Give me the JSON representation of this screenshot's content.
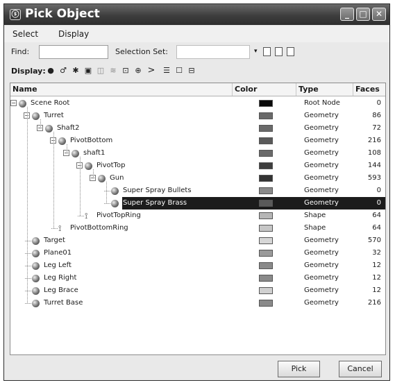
{
  "window": {
    "title": "Pick Object",
    "icon": "max-app-icon"
  },
  "menu": [
    "Select",
    "Display"
  ],
  "find": {
    "label": "Find:",
    "value": "",
    "selection_set_label": "Selection Set:",
    "selection_set_value": ""
  },
  "display_label": "Display:",
  "columns": {
    "name": "Name",
    "color": "Color",
    "type": "Type",
    "faces": "Faces"
  },
  "rows": [
    {
      "name": "Scene Root",
      "type": "Root Node",
      "faces": "0",
      "color": "#0a0a0a",
      "level": 0,
      "icon": "scene-root-icon"
    },
    {
      "name": "Turret",
      "type": "Geometry",
      "faces": "86",
      "color": "#6a6a6a",
      "level": 1,
      "icon": "geometry-sphere-icon"
    },
    {
      "name": "Shaft2",
      "type": "Geometry",
      "faces": "72",
      "color": "#6a6a6a",
      "level": 2,
      "icon": "geometry-sphere-icon"
    },
    {
      "name": "PivotBottom",
      "type": "Geometry",
      "faces": "216",
      "color": "#5a5a5a",
      "level": 3,
      "icon": "geometry-sphere-icon"
    },
    {
      "name": "shaft1",
      "type": "Geometry",
      "faces": "108",
      "color": "#6a6a6a",
      "level": 4,
      "icon": "geometry-sphere-icon"
    },
    {
      "name": "PivotTop",
      "type": "Geometry",
      "faces": "144",
      "color": "#3e3e3e",
      "level": 5,
      "icon": "geometry-sphere-icon"
    },
    {
      "name": "Gun",
      "type": "Geometry",
      "faces": "593",
      "color": "#333333",
      "level": 6,
      "icon": "geometry-sphere-icon"
    },
    {
      "name": "Super Spray Bullets",
      "type": "Geometry",
      "faces": "0",
      "color": "#8a8a8a",
      "level": 7,
      "icon": "particle-system-icon"
    },
    {
      "name": "Super Spray Brass",
      "type": "Geometry",
      "faces": "0",
      "color": "#5a5a5a",
      "level": 7,
      "icon": "particle-system-icon",
      "selected": true
    },
    {
      "name": "PivotTopRing",
      "type": "Shape",
      "faces": "64",
      "color": "#b6b6b6",
      "level": 5,
      "icon": "shape-icon"
    },
    {
      "name": "PivotBottomRing",
      "type": "Shape",
      "faces": "64",
      "color": "#c6c6c6",
      "level": 3,
      "icon": "shape-icon"
    },
    {
      "name": "Target",
      "type": "Geometry",
      "faces": "570",
      "color": "#d6d6d6",
      "level": 1,
      "icon": "geometry-sphere-icon"
    },
    {
      "name": "Plane01",
      "type": "Geometry",
      "faces": "32",
      "color": "#9a9a9a",
      "level": 1,
      "icon": "geometry-sphere-icon"
    },
    {
      "name": "Leg Left",
      "type": "Geometry",
      "faces": "12",
      "color": "#8a8a8a",
      "level": 1,
      "icon": "geometry-sphere-icon"
    },
    {
      "name": "Leg Right",
      "type": "Geometry",
      "faces": "12",
      "color": "#8a8a8a",
      "level": 1,
      "icon": "geometry-sphere-icon"
    },
    {
      "name": "Leg Brace",
      "type": "Geometry",
      "faces": "12",
      "color": "#d0d0d0",
      "level": 1,
      "icon": "geometry-sphere-icon"
    },
    {
      "name": "Turret Base",
      "type": "Geometry",
      "faces": "216",
      "color": "#8a8a8a",
      "level": 1,
      "icon": "geometry-sphere-icon"
    }
  ],
  "buttons": {
    "pick": "Pick",
    "cancel": "Cancel"
  }
}
